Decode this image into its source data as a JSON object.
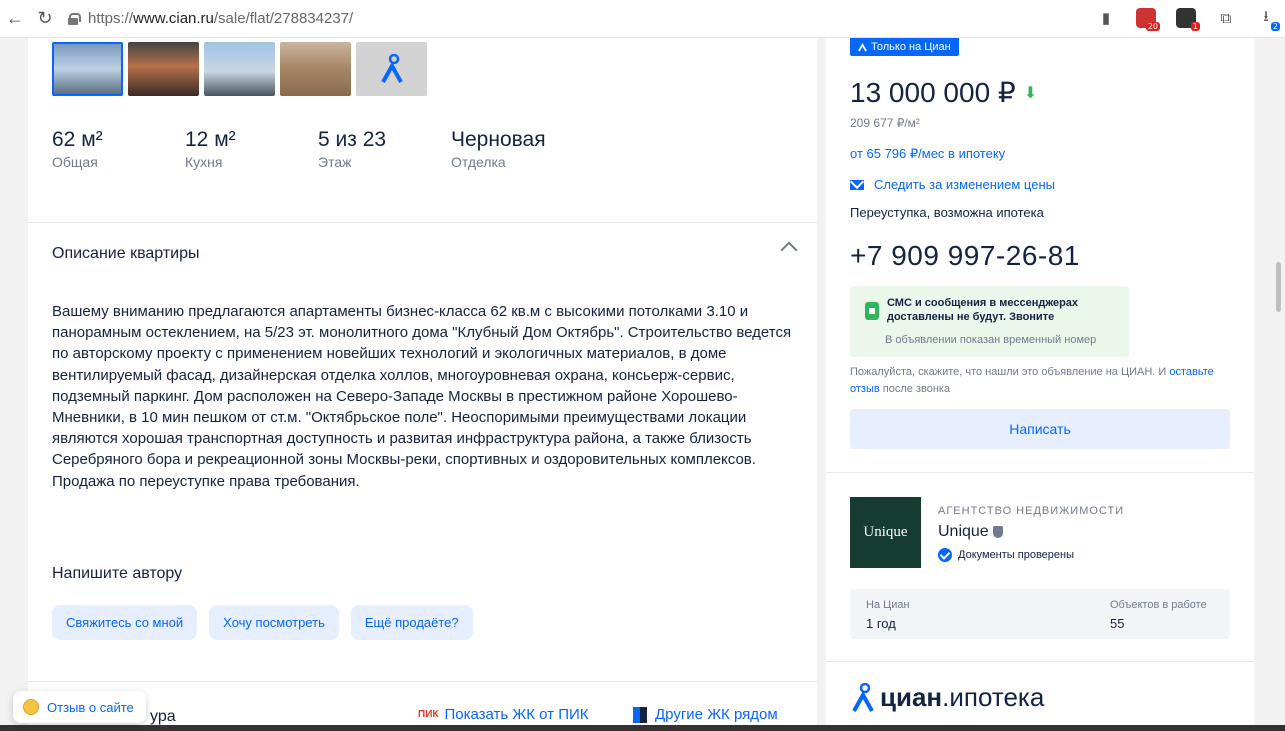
{
  "browser": {
    "url_prefix": "https://",
    "url_domain": "www.cian.ru",
    "url_path": "/sale/flat/278834237/",
    "ext_badge_1": "20",
    "ext_badge_2": "1",
    "download_badge": "2"
  },
  "gallery": {
    "thumb_count": 5
  },
  "stats": [
    {
      "value": "62 м²",
      "label": "Общая"
    },
    {
      "value": "12 м²",
      "label": "Кухня"
    },
    {
      "value": "5 из 23",
      "label": "Этаж"
    },
    {
      "value": "Черновая",
      "label": "Отделка"
    }
  ],
  "description": {
    "title": "Описание квартиры",
    "text": "Вашему вниманию предлагаются апартаменты бизнес-класса 62 кв.м с высокими потолками 3.10 и панорамным остеклением, на 5/23 эт. монолитного дома \"Клубный Дом Октябрь\". Строительство ведется по авторскому проекту с применением новейших технологий и экологичных материалов, в доме вентилируемый  фасад, дизайнерская отделка холлов, многоуровневая охрана, консьерж-сервис, подземный паркинг. Дом расположен на Северо-Западе Москвы в престижном районе Хорошево-Мневники, в 10 мин пешком от ст.м. \"Октябрьское поле\". Неоспоримыми преимуществами локации являются хорошая транспортная доступность и развитая инфраструктура района, а также близость Серебряного бора и рекреационной зоны Москвы-реки, спортивных и оздоровительных комплексов. Продажа по переуступке права требования."
  },
  "author": {
    "title": "Напишите автору",
    "chips": [
      "Свяжитесь со мной",
      "Хочу посмотреть",
      "Ещё продаёте?"
    ]
  },
  "bottom": {
    "caption": "ура",
    "pik_logo": "ПИК",
    "pik_link": "Показать ЖК от ПИК",
    "others_link": "Другие ЖК рядом"
  },
  "feedback": {
    "label": "Отзыв о сайте"
  },
  "offer": {
    "tag": "Только на Циан",
    "price": "13 000 000 ₽",
    "price_per_meter": "209 677 ₽/м²",
    "mortgage": "от 65 796 ₽/мес в ипотеку",
    "follow": "Следить за изменением цены",
    "terms": "Переуступка, возможна ипотека",
    "phone": "+7 909 997-26-81",
    "sms_notice": "СМС и сообщения в мессенджерах доставлены не будут. Звоните",
    "sms_sub": "В объявлении показан временный номер",
    "ask_text_1": "Пожалуйста, скажите, что нашли это объявление на ЦИАН. И",
    "ask_link": "оставьте отзыв",
    "ask_text_2": "после звонка",
    "write_button": "Написать"
  },
  "agency": {
    "logo_text": "Unique",
    "kind": "АГЕНТСТВО НЕДВИЖИМОСТИ",
    "name": "Unique",
    "verified": "Документы проверены",
    "on_cian_label": "На Циан",
    "on_cian_value": "1 год",
    "objects_label": "Объектов в работе",
    "objects_value": "55"
  },
  "cian_ipoteka": {
    "bold": "циан",
    "rest": ".ипотека"
  },
  "colors": {
    "accent": "#0468ff",
    "text": "#152242",
    "muted": "#737a8e",
    "green": "#2fb55a"
  }
}
